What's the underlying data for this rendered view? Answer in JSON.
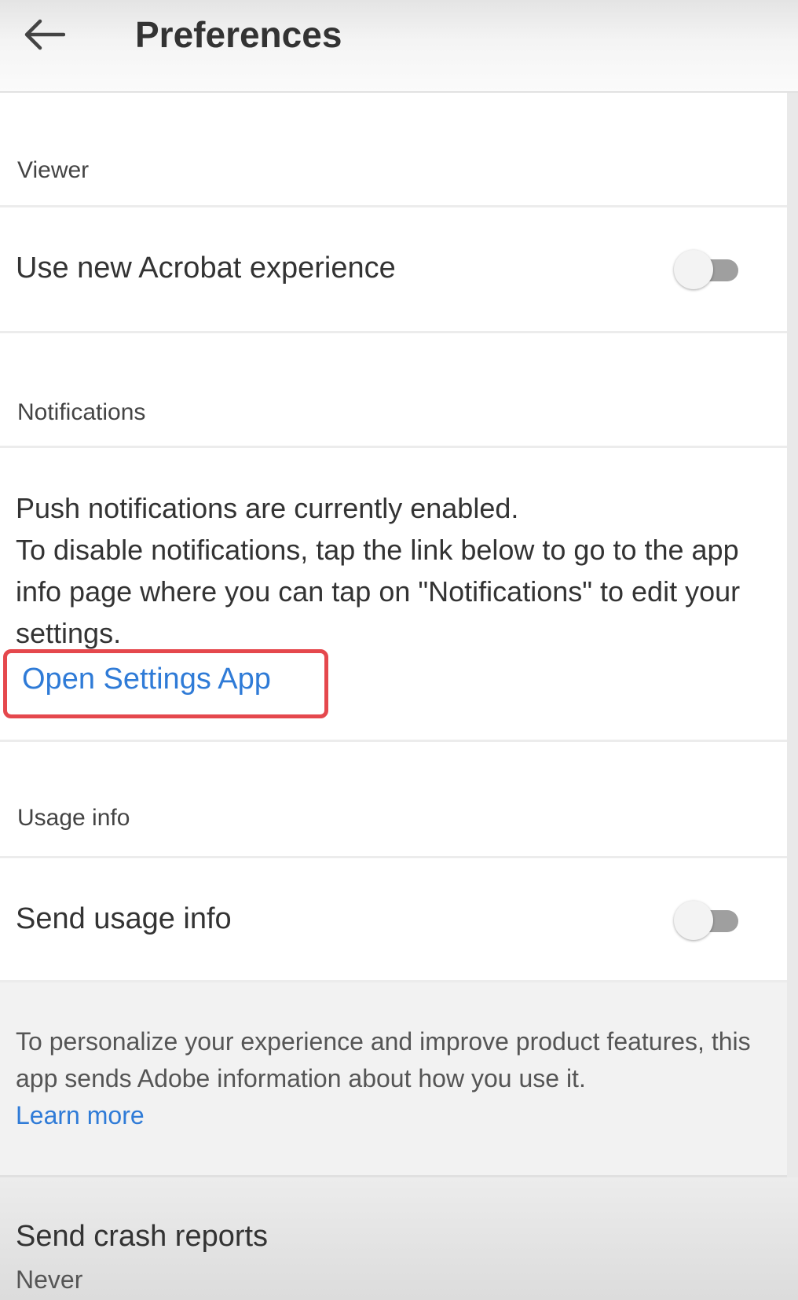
{
  "app_bar": {
    "title": "Preferences",
    "back_icon": "arrow-left-icon"
  },
  "sections": {
    "viewer": {
      "header": "Viewer",
      "items": [
        {
          "label": "Use new Acrobat experience",
          "toggle_on": false
        }
      ]
    },
    "notifications": {
      "header": "Notifications",
      "status_text": "Push notifications are currently enabled.",
      "help_text": "To disable notifications, tap the link below to go to the app info page where you can tap on \"Notifications\" to edit your settings.",
      "link_label": "Open Settings App"
    },
    "usage_info": {
      "header": "Usage info",
      "items": [
        {
          "label": "Send usage info",
          "toggle_on": false
        }
      ],
      "description": "To personalize your experience and improve product features, this app sends Adobe information about how you use it.",
      "learn_more_label": "Learn more"
    },
    "crash_reports": {
      "label": "Send crash reports",
      "value": "Never"
    }
  },
  "colors": {
    "link": "#2f7bd7",
    "highlight": "#e5484d",
    "toggle_track": "#9f9f9f",
    "toggle_knob": "#f3f3f3"
  }
}
